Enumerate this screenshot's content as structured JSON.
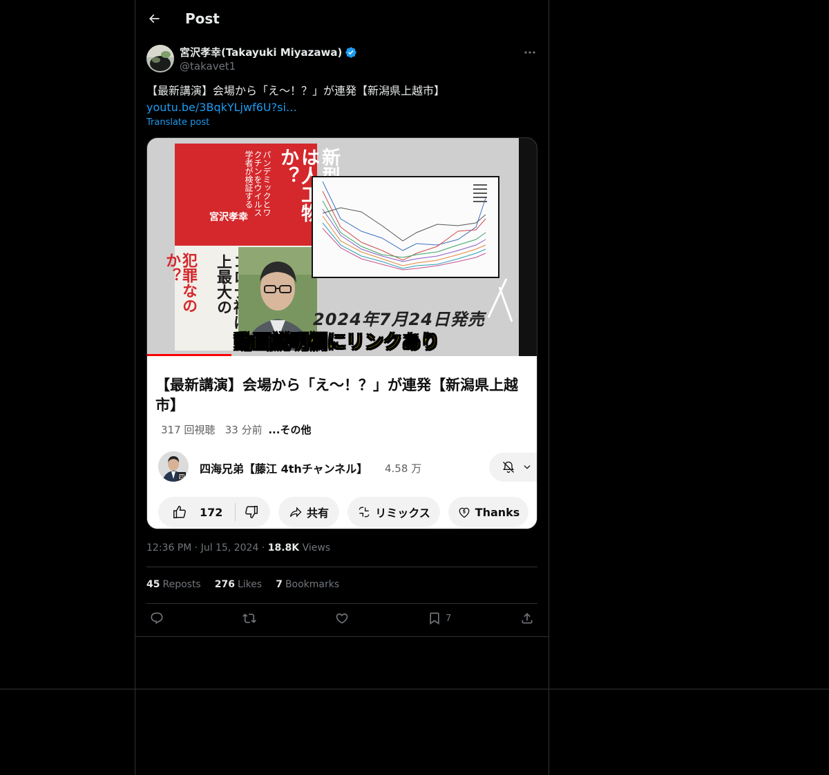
{
  "header": {
    "title": "Post"
  },
  "author": {
    "name": "宮沢孝幸(Takayuki Miyazawa)",
    "handle": "@takavet1"
  },
  "tweet": {
    "text": "【最新講演】会場から「え〜！？」が連発【新潟県上越市】",
    "link": "youtu.be/3BqkYLjwf6U?si…",
    "translate": "Translate post"
  },
  "media": {
    "book_title": "新型コロナは人工物か？",
    "book_subtitle": "パンデミックとワクチンをウイルス学者が検証する",
    "book_author": "宮沢孝幸",
    "book_tagline": "コロナ禍は史上最大の",
    "book_tagline_red": "犯罪なのか？",
    "release_text": "2024年7月24日発売",
    "banner_text": "動画説明欄にリンクあり",
    "yt_title": "【最新講演】会場から「え〜！？」が連発【新潟県上越市】",
    "yt_views": "317 回視聴",
    "yt_time": "33 分前",
    "yt_more": "...その他",
    "channel_name": "四海兄弟【藤江 4thチャンネル】",
    "channel_subs": "4.58 万",
    "like_count": "172",
    "share_label": "共有",
    "remix_label": "リミックス",
    "thanks_label": "Thanks"
  },
  "meta": {
    "time": "12:36 PM",
    "date": "Jul 15, 2024",
    "views_count": "18.8K",
    "views_label": "Views"
  },
  "stats": {
    "reposts_count": "45",
    "reposts_label": "Reposts",
    "likes_count": "276",
    "likes_label": "Likes",
    "bookmarks_count": "7",
    "bookmarks_label": "Bookmarks"
  },
  "actions": {
    "bookmark_count": "7"
  },
  "colors": {
    "background": "#000000",
    "text": "#e7e9ea",
    "muted": "#71767b",
    "link": "#1d9bf0",
    "border": "#2f3336"
  }
}
